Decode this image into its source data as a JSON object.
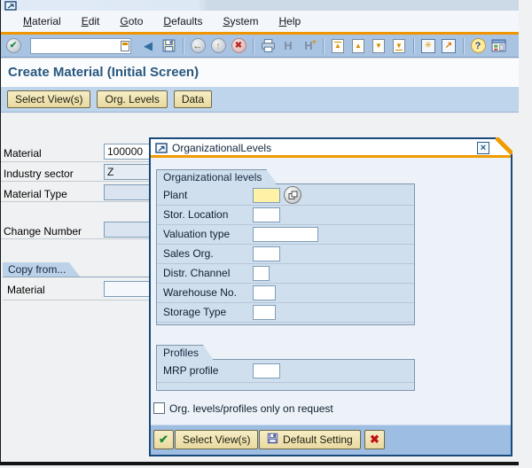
{
  "window": {
    "menu_items": [
      "Material",
      "Edit",
      "Goto",
      "Defaults",
      "System",
      "Help"
    ],
    "command_value": ""
  },
  "screen": {
    "title": "Create Material (Initial Screen)",
    "app_buttons": [
      "Select View(s)",
      "Org. Levels",
      "Data"
    ]
  },
  "form": {
    "material": {
      "label": "Material",
      "value": "100000"
    },
    "industry_sector": {
      "label": "Industry sector",
      "value": "Z"
    },
    "material_type": {
      "label": "Material Type",
      "value": ""
    },
    "change_number": {
      "label": "Change Number",
      "value": ""
    },
    "copy_from": {
      "header": "Copy from...",
      "material_label": "Material",
      "material_value": ""
    }
  },
  "dialog": {
    "title": "OrganizationalLevels",
    "org_levels": {
      "header": "Organizational levels",
      "fields": [
        {
          "label": "Plant",
          "value": ""
        },
        {
          "label": "Stor. Location",
          "value": ""
        },
        {
          "label": "Valuation type",
          "value": ""
        },
        {
          "label": "Sales Org.",
          "value": ""
        },
        {
          "label": "Distr. Channel",
          "value": ""
        },
        {
          "label": "Warehouse No.",
          "value": ""
        },
        {
          "label": "Storage Type",
          "value": ""
        }
      ]
    },
    "profiles": {
      "header": "Profiles",
      "fields": [
        {
          "label": "MRP profile",
          "value": ""
        }
      ]
    },
    "checkbox": {
      "label": "Org. levels/profiles only on request",
      "checked": false
    },
    "footer": {
      "select_views": "Select View(s)",
      "default_setting": "Default Setting"
    }
  },
  "icons": {
    "enter": "✔",
    "back": "◀",
    "back_circle": "←",
    "exit_circle": "↑",
    "cancel_circle": "✖",
    "find": "H",
    "find_plus": "+",
    "page_up": "▲",
    "page_down": "▼",
    "new_session": "✳",
    "shortcut": "↗",
    "help": "?",
    "dialog_close": "×",
    "continue": "✔",
    "cancel": "✖"
  },
  "colors": {
    "accent_orange": "#f09c00",
    "toolbar_blue": "#a9c4e2",
    "appbar_blue": "#bfd5ec",
    "button_tan": "#efe2ae",
    "field_highlight": "#fff2a6",
    "dialog_border": "#19497b",
    "footer_blue": "#9dbde3",
    "title_text": "#27577f"
  }
}
